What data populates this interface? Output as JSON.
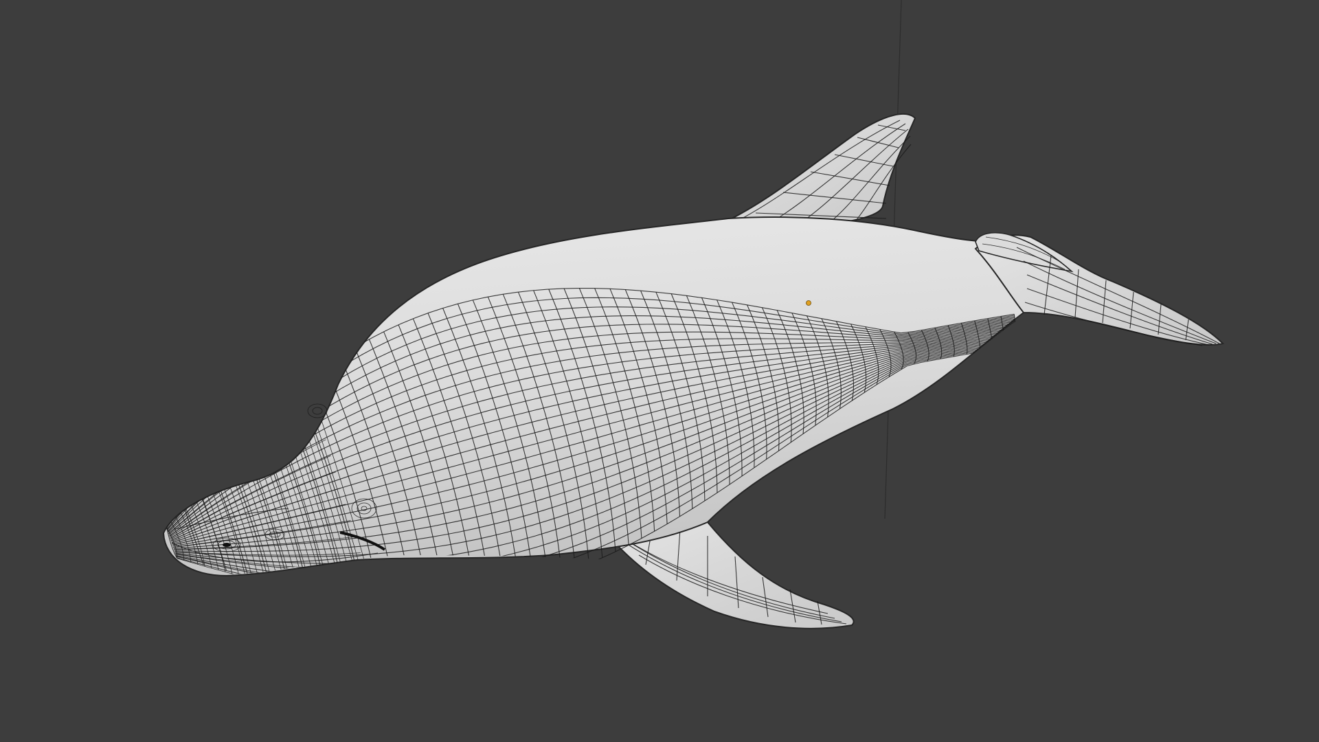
{
  "viewport": {
    "background_color": "#3d3d3d",
    "mesh_color": "#d6d6d6",
    "wire_color": "#1a1a1a",
    "origin_color": "#e0a020",
    "object": "dolphin-mesh",
    "display_mode": "solid-wireframe-overlay"
  }
}
